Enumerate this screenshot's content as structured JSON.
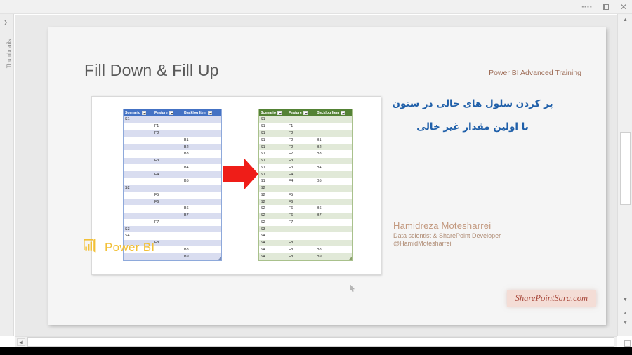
{
  "window": {
    "controls": [
      {
        "name": "more-options",
        "glyph": "••••"
      },
      {
        "name": "restore-window",
        "glyph": ""
      },
      {
        "name": "close-window",
        "glyph": "×"
      }
    ]
  },
  "rail": {
    "label": "Thumbnails",
    "chevron": "❯"
  },
  "slide": {
    "title": "Fill Down & Fill Up",
    "header_right": "Power BI Advanced Training",
    "rule_color": "#c0643c"
  },
  "callout": {
    "line1": "پر کردن سلول های خالی در ستون",
    "line2": "با اولین مقدار غیر خالی",
    "color": "#1f5fa9"
  },
  "author": {
    "name": "Hamidreza Motesharrei",
    "role": "Data scientist & SharePoint Developer",
    "handle": "@HamidMotesharrei",
    "color": "#c2987e"
  },
  "brand": {
    "label": "Power BI",
    "color": "#f2c037"
  },
  "watermark": {
    "text": "SharePointSara.com",
    "color": "#a8473a",
    "background": "#f4ddd6"
  },
  "tables": {
    "headers": [
      "Scenario",
      "Feature",
      "Backlog Item"
    ],
    "before": {
      "accent": "#4472c4",
      "band": "#d9ddf0",
      "rows": [
        [
          "S1",
          "",
          ""
        ],
        [
          "",
          "F1",
          ""
        ],
        [
          "",
          "F2",
          ""
        ],
        [
          "",
          "",
          "B1"
        ],
        [
          "",
          "",
          "B2"
        ],
        [
          "",
          "",
          "B3"
        ],
        [
          "",
          "F3",
          ""
        ],
        [
          "",
          "",
          "B4"
        ],
        [
          "",
          "F4",
          ""
        ],
        [
          "",
          "",
          "B5"
        ],
        [
          "S2",
          "",
          ""
        ],
        [
          "",
          "F5",
          ""
        ],
        [
          "",
          "F6",
          ""
        ],
        [
          "",
          "",
          "B6"
        ],
        [
          "",
          "",
          "B7"
        ],
        [
          "",
          "F7",
          ""
        ],
        [
          "S3",
          "",
          ""
        ],
        [
          "S4",
          "",
          ""
        ],
        [
          "",
          "F8",
          ""
        ],
        [
          "",
          "",
          "B8"
        ],
        [
          "",
          "",
          "B9"
        ]
      ]
    },
    "after": {
      "accent": "#548235",
      "band": "#e1e9d8",
      "rows": [
        [
          "S1",
          "",
          ""
        ],
        [
          "S1",
          "F1",
          ""
        ],
        [
          "S1",
          "F2",
          ""
        ],
        [
          "S1",
          "F2",
          "B1"
        ],
        [
          "S1",
          "F2",
          "B2"
        ],
        [
          "S1",
          "F2",
          "B3"
        ],
        [
          "S1",
          "F3",
          ""
        ],
        [
          "S1",
          "F3",
          "B4"
        ],
        [
          "S1",
          "F4",
          ""
        ],
        [
          "S1",
          "F4",
          "B5"
        ],
        [
          "S2",
          "",
          ""
        ],
        [
          "S2",
          "F5",
          ""
        ],
        [
          "S2",
          "F6",
          ""
        ],
        [
          "S2",
          "F6",
          "B6"
        ],
        [
          "S2",
          "F6",
          "B7"
        ],
        [
          "S2",
          "F7",
          ""
        ],
        [
          "S3",
          "",
          ""
        ],
        [
          "S4",
          "",
          ""
        ],
        [
          "S4",
          "F8",
          ""
        ],
        [
          "S4",
          "F8",
          "B8"
        ],
        [
          "S4",
          "F8",
          "B9"
        ]
      ]
    }
  }
}
